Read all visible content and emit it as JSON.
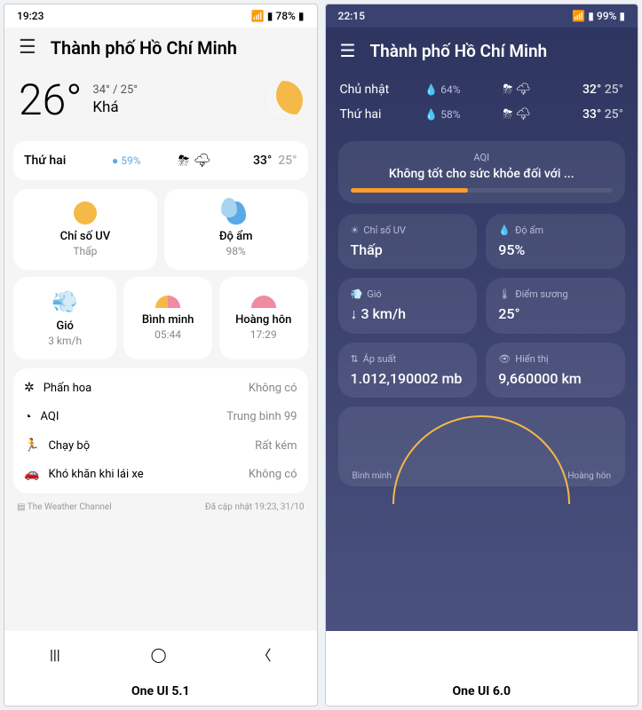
{
  "left": {
    "label": "One UI 5.1",
    "status": {
      "time": "19:23",
      "battery": "78%"
    },
    "city": "Thành phố Hồ Chí Minh",
    "hero": {
      "temp": "26°",
      "hilo": "34° / 25°",
      "cond": "Khá"
    },
    "forecast": {
      "day": "Thứ hai",
      "pop": "● 59%",
      "hi": "33°",
      "lo": "25°"
    },
    "cards": {
      "uv": {
        "label": "Chỉ số UV",
        "value": "Thấp"
      },
      "humidity": {
        "label": "Độ ẩm",
        "value": "98%"
      },
      "wind": {
        "label": "Gió",
        "value": "3 km/h"
      },
      "sunrise": {
        "label": "Bình minh",
        "value": "05:44"
      },
      "sunset": {
        "label": "Hoàng hôn",
        "value": "17:29"
      }
    },
    "info": [
      {
        "icon": "✲",
        "label": "Phấn hoa",
        "value": "Không có"
      },
      {
        "icon": "◔",
        "label": "AQI",
        "value": "Trung bình 99"
      },
      {
        "icon": "🏃",
        "label": "Chạy bộ",
        "value": "Rất kém"
      },
      {
        "icon": "🚗",
        "label": "Khó khăn khi lái xe",
        "value": "Không có"
      }
    ],
    "footer": {
      "provider": "▤ The Weather Channel",
      "updated": "Đã cập nhật 19:23, 31/10"
    }
  },
  "right": {
    "label": "One UI 6.0",
    "status": {
      "time": "22:15",
      "battery": "99%"
    },
    "city": "Thành phố Hồ Chí Minh",
    "forecast": [
      {
        "day": "Chủ nhật",
        "pop": "64%",
        "hi": "32°",
        "lo": "25°"
      },
      {
        "day": "Thứ hai",
        "pop": "58%",
        "hi": "33°",
        "lo": "25°"
      }
    ],
    "aqi": {
      "title": "AQI",
      "text": "Không tốt cho sức khỏe đối với ..."
    },
    "cards": {
      "uv": {
        "label": "Chỉ số UV",
        "value": "Thấp"
      },
      "humidity": {
        "label": "Độ ẩm",
        "value": "95%"
      },
      "wind": {
        "label": "Gió",
        "value": "↓ 3 km/h"
      },
      "dew": {
        "label": "Điểm sương",
        "value": "25°"
      },
      "pressure": {
        "label": "Áp suất",
        "value": "1.012,190002 mb"
      },
      "visibility": {
        "label": "Hiển thị",
        "value": "9,660000 km"
      }
    },
    "sun": {
      "sunrise": "Bình minh",
      "sunset": "Hoàng hôn"
    }
  }
}
